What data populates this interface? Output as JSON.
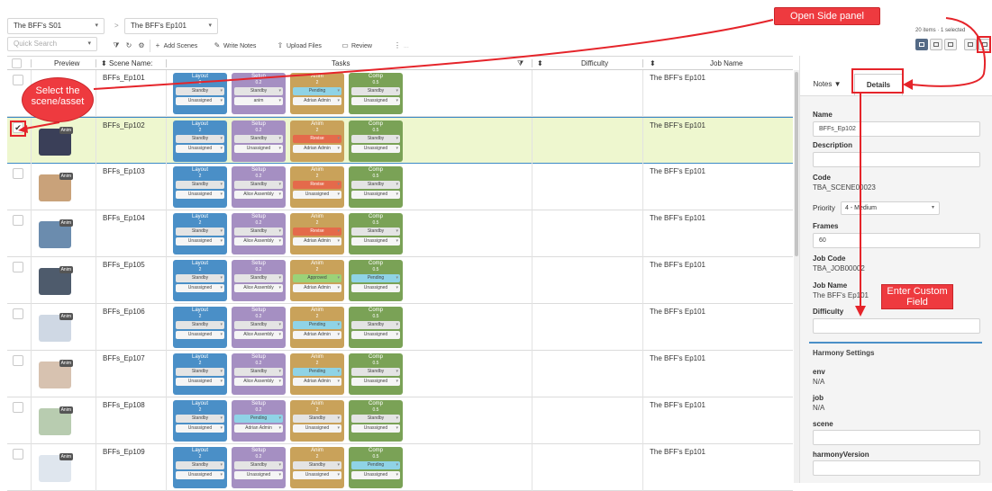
{
  "header": {
    "project": "The BFF's S01",
    "breadcrumb_sep": ">",
    "episode": "The BFF's Ep101",
    "search_placeholder": "Quick Search",
    "toolbar": {
      "add_scenes": "Add Scenes",
      "write_notes": "Write Notes",
      "upload_files": "Upload Files",
      "review": "Review",
      "hidden": "..."
    },
    "status": "20 items · 1 selected"
  },
  "grid": {
    "columns": {
      "preview": "Preview",
      "scene_name": "Scene Name:",
      "tasks": "Tasks",
      "difficulty": "Difficulty",
      "job_name": "Job Name"
    },
    "rows": [
      {
        "name": "BFFs_Ep101",
        "job": "The BFF's Ep101",
        "selected": false,
        "tasks": {
          "layout": [
            "Standby",
            "Unassigned"
          ],
          "setup": [
            "Standby",
            "anim"
          ],
          "anim": [
            "Pending",
            "Adrian Admin"
          ],
          "comp": [
            "Standby",
            "Unassigned"
          ]
        }
      },
      {
        "name": "BFFs_Ep102",
        "job": "The BFF's Ep101",
        "selected": true,
        "tasks": {
          "layout": [
            "Standby",
            "Unassigned"
          ],
          "setup": [
            "Standby",
            "Unassigned"
          ],
          "anim": [
            "Revise",
            "Adrian Admin"
          ],
          "comp": [
            "Standby",
            "Unassigned"
          ]
        }
      },
      {
        "name": "BFFs_Ep103",
        "job": "The BFF's Ep101",
        "selected": false,
        "tasks": {
          "layout": [
            "Standby",
            "Unassigned"
          ],
          "setup": [
            "Standby",
            "Alice Assembly"
          ],
          "anim": [
            "Revise",
            "Unassigned"
          ],
          "comp": [
            "Standby",
            "Unassigned"
          ]
        }
      },
      {
        "name": "BFFs_Ep104",
        "job": "The BFF's Ep101",
        "selected": false,
        "tasks": {
          "layout": [
            "Standby",
            "Unassigned"
          ],
          "setup": [
            "Standby",
            "Alice Assembly"
          ],
          "anim": [
            "Revise",
            "Adrian Admin"
          ],
          "comp": [
            "Standby",
            "Unassigned"
          ]
        }
      },
      {
        "name": "BFFs_Ep105",
        "job": "The BFF's Ep101",
        "selected": false,
        "tasks": {
          "layout": [
            "Standby",
            "Unassigned"
          ],
          "setup": [
            "Standby",
            "Alice Assembly"
          ],
          "anim": [
            "Approved",
            "Adrian Admin"
          ],
          "comp": [
            "Pending",
            "Unassigned"
          ]
        }
      },
      {
        "name": "BFFs_Ep106",
        "job": "The BFF's Ep101",
        "selected": false,
        "tasks": {
          "layout": [
            "Standby",
            "Unassigned"
          ],
          "setup": [
            "Standby",
            "Alice Assembly"
          ],
          "anim": [
            "Pending",
            "Adrian Admin"
          ],
          "comp": [
            "Standby",
            "Unassigned"
          ]
        }
      },
      {
        "name": "BFFs_Ep107",
        "job": "The BFF's Ep101",
        "selected": false,
        "tasks": {
          "layout": [
            "Standby",
            "Unassigned"
          ],
          "setup": [
            "Standby",
            "Alice Assembly"
          ],
          "anim": [
            "Pending",
            "Adrian Admin"
          ],
          "comp": [
            "Standby",
            "Unassigned"
          ]
        }
      },
      {
        "name": "BFFs_Ep108",
        "job": "The BFF's Ep101",
        "selected": false,
        "tasks": {
          "layout": [
            "Standby",
            "Unassigned"
          ],
          "setup": [
            "Pending",
            "Adrian Admin"
          ],
          "anim": [
            "Standby",
            "Unassigned"
          ],
          "comp": [
            "Standby",
            "Unassigned"
          ]
        }
      },
      {
        "name": "BFFs_Ep109",
        "job": "The BFF's Ep101",
        "selected": false,
        "tasks": {
          "layout": [
            "Standby",
            "Unassigned"
          ],
          "setup": [
            "Standby",
            "Unassigned"
          ],
          "anim": [
            "Standby",
            "Unassigned"
          ],
          "comp": [
            "Pending",
            "Unassigned"
          ]
        }
      }
    ],
    "task_labels": {
      "layout": {
        "name": "Layout",
        "num": "2"
      },
      "setup": {
        "name": "Setup",
        "num": "0.2"
      },
      "anim": {
        "name": "Anim",
        "num": "2"
      },
      "comp": {
        "name": "Comp",
        "num": "0.5"
      }
    },
    "thumb_tag": "Anim"
  },
  "side_panel": {
    "tabs": {
      "notes": "Notes",
      "details": "Details"
    },
    "fields": {
      "name_label": "Name",
      "name_value": "BFFs_Ep102",
      "description_label": "Description",
      "code_label": "Code",
      "code_value": "TBA_SCENE00023",
      "priority_label": "Priority",
      "priority_value": "4 - Medium",
      "frames_label": "Frames",
      "frames_value": "60",
      "job_code_label": "Job Code",
      "job_code_value": "TBA_JOB00002",
      "job_name_label": "Job Name",
      "job_name_value": "The BFF's Ep101",
      "difficulty_label": "Difficulty"
    },
    "harmony": {
      "title": "Harmony Settings",
      "env_label": "env",
      "env_value": "N/A",
      "job_label": "job",
      "job_value": "N/A",
      "scene_label": "scene",
      "version_label": "harmonyVersion"
    }
  },
  "annotations": {
    "select": "Select the scene/asset",
    "open_panel": "Open Side panel",
    "custom_field": "Enter Custom Field"
  },
  "colors": {
    "accent": "#4a8fc7",
    "callout": "#ee3a3f",
    "selected_row": "#eef7cf",
    "revise": "#e46a4b",
    "pending": "#8fd3e6",
    "approved": "#9bd278"
  },
  "thumb_colors": [
    "#5b8fb7",
    "#3a3f58",
    "#c9a27a",
    "#6b8cae",
    "#4e5b6c",
    "#cfd8e4",
    "#d7c2b0",
    "#b8ccb0",
    "#dfe6ee"
  ]
}
